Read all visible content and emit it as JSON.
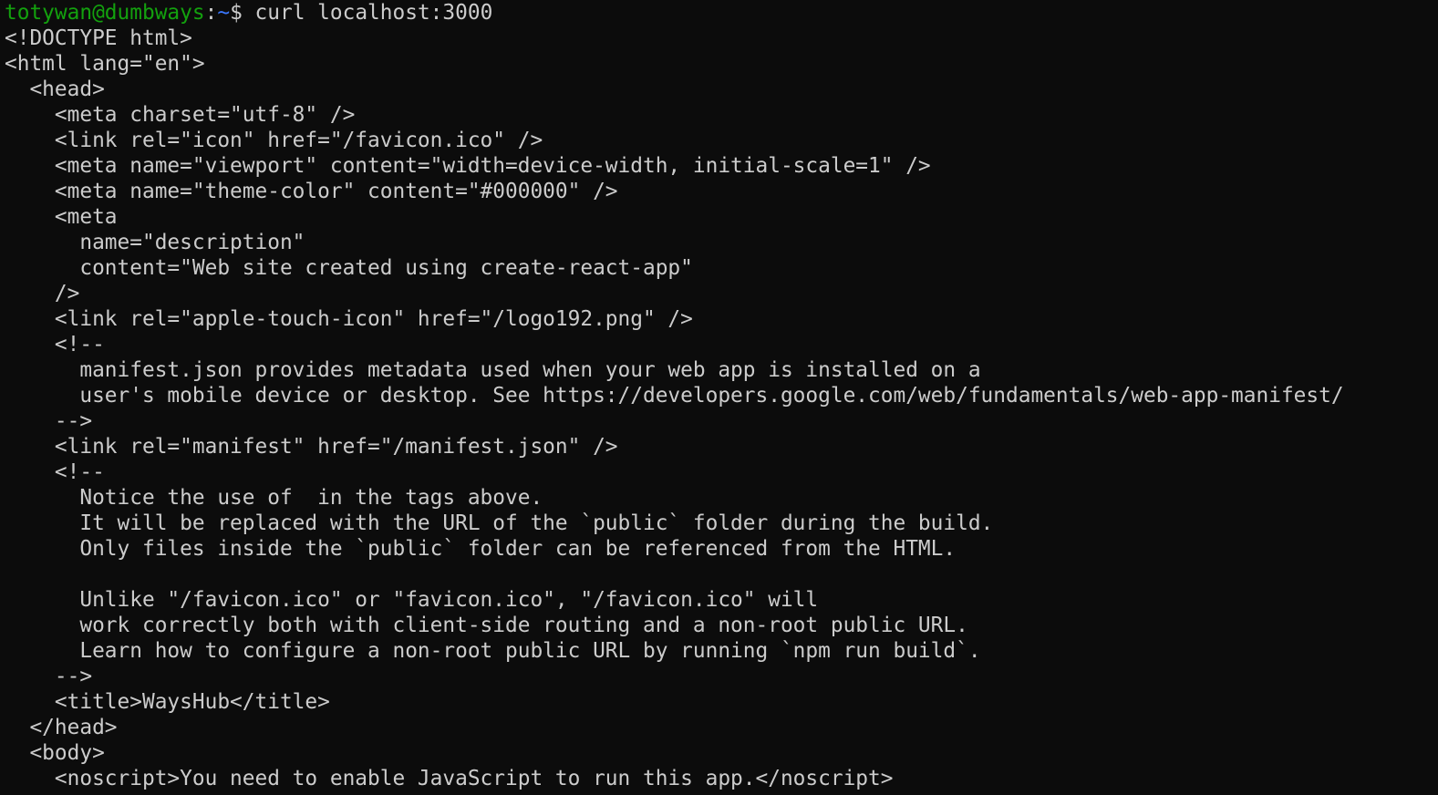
{
  "prompt": {
    "user_host": "totywan@dumbways",
    "separator": ":",
    "path": "~",
    "symbol": "$ ",
    "command": "curl localhost:3000"
  },
  "colors": {
    "background": "#0c0c0c",
    "text": "#cccccc",
    "prompt_user": "#13a10e",
    "prompt_path": "#3b78ff"
  },
  "output_lines": [
    "<!DOCTYPE html>",
    "<html lang=\"en\">",
    "  <head>",
    "    <meta charset=\"utf-8\" />",
    "    <link rel=\"icon\" href=\"/favicon.ico\" />",
    "    <meta name=\"viewport\" content=\"width=device-width, initial-scale=1\" />",
    "    <meta name=\"theme-color\" content=\"#000000\" />",
    "    <meta",
    "      name=\"description\"",
    "      content=\"Web site created using create-react-app\"",
    "    />",
    "    <link rel=\"apple-touch-icon\" href=\"/logo192.png\" />",
    "    <!--",
    "      manifest.json provides metadata used when your web app is installed on a",
    "      user's mobile device or desktop. See https://developers.google.com/web/fundamentals/web-app-manifest/",
    "    -->",
    "    <link rel=\"manifest\" href=\"/manifest.json\" />",
    "    <!--",
    "      Notice the use of  in the tags above.",
    "      It will be replaced with the URL of the `public` folder during the build.",
    "      Only files inside the `public` folder can be referenced from the HTML.",
    "",
    "      Unlike \"/favicon.ico\" or \"favicon.ico\", \"/favicon.ico\" will",
    "      work correctly both with client-side routing and a non-root public URL.",
    "      Learn how to configure a non-root public URL by running `npm run build`.",
    "    -->",
    "    <title>WaysHub</title>",
    "  </head>",
    "  <body>",
    "    <noscript>You need to enable JavaScript to run this app.</noscript>"
  ]
}
